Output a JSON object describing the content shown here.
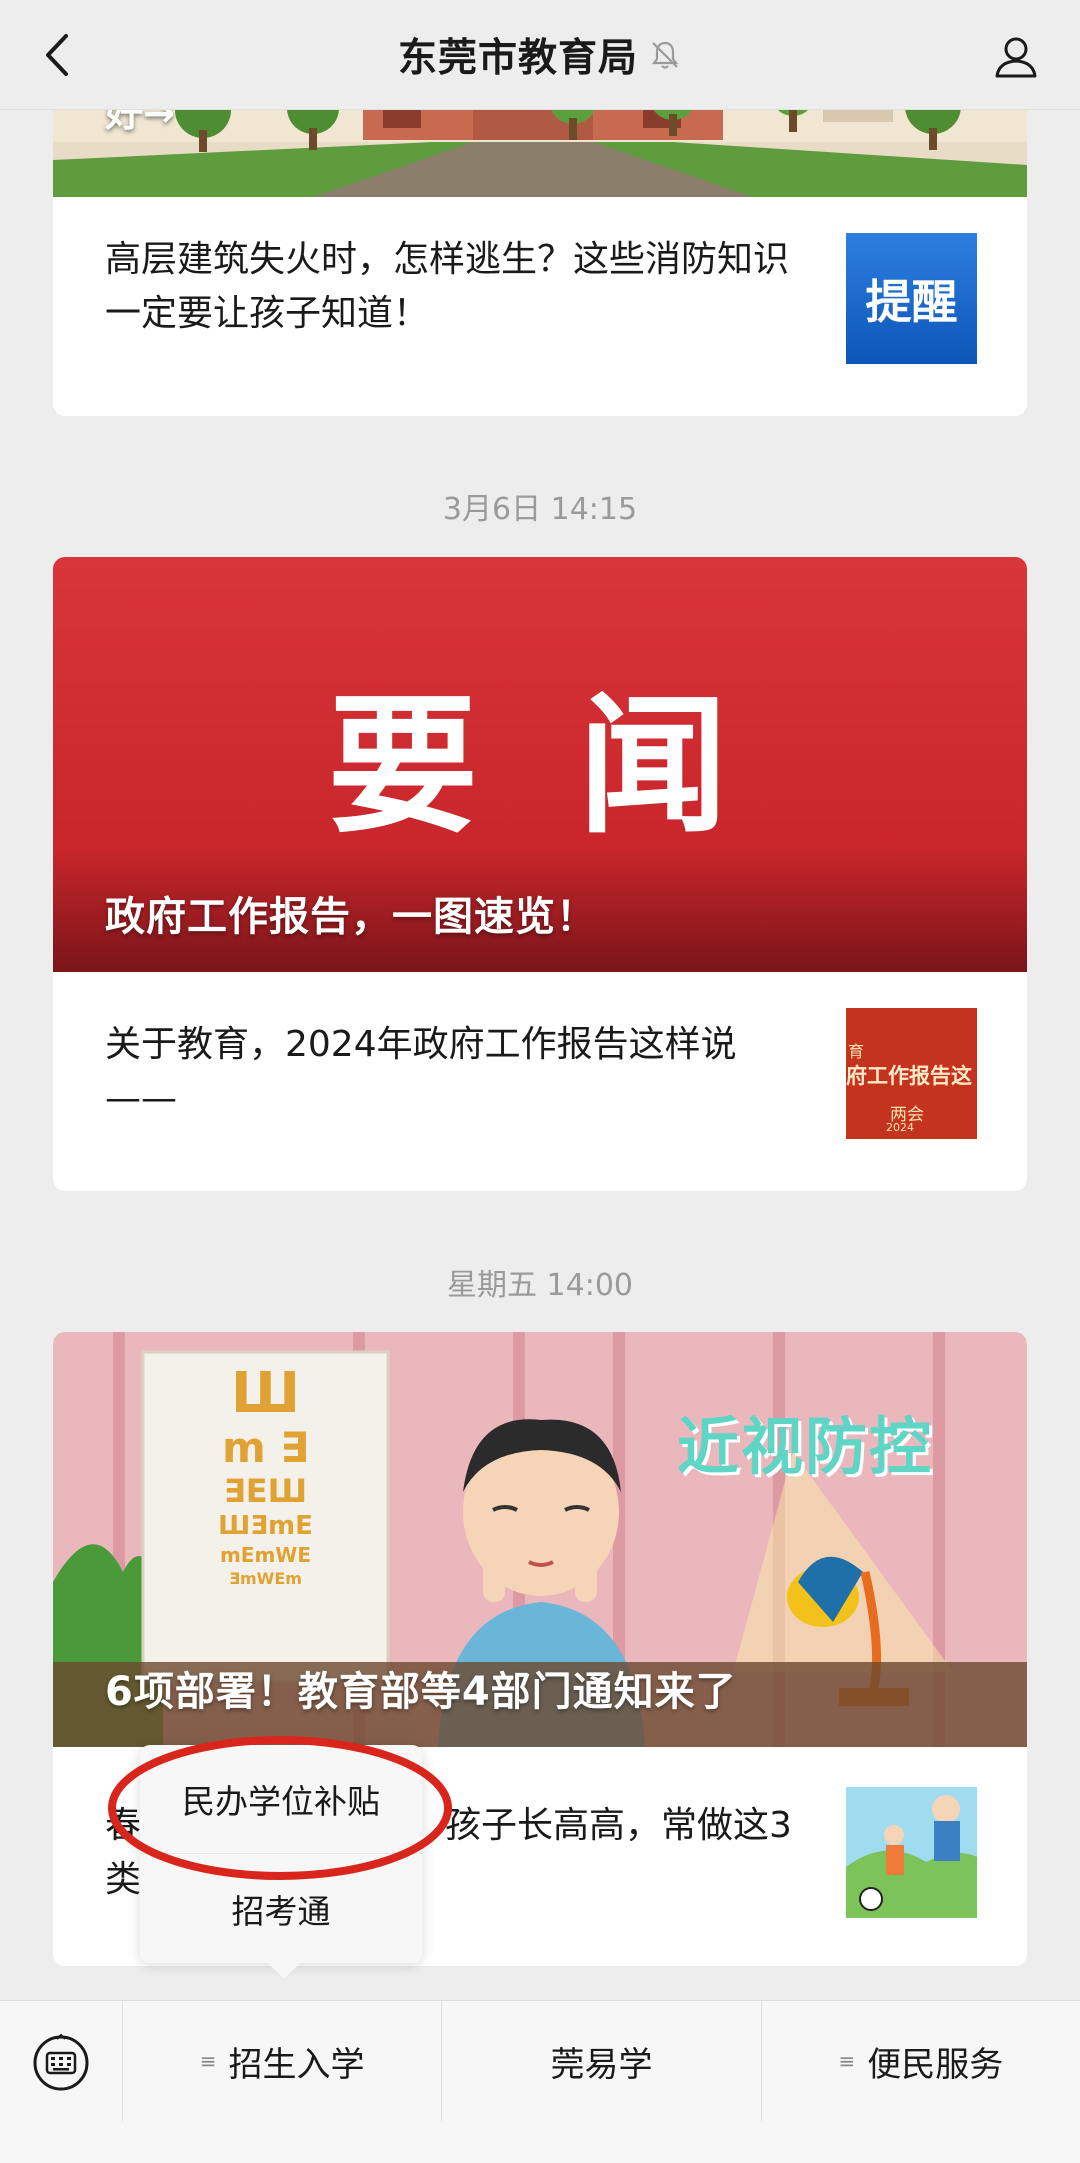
{
  "header": {
    "title": "东莞市教育局",
    "back_icon": "chevron-left-icon",
    "mute_icon": "bell-off-icon",
    "profile_icon": "person-icon"
  },
  "articles": [
    {
      "cover_title": "好→",
      "sub_text": "高层建筑失火时，怎样逃生？这些消防知识一定要让孩子知道！",
      "thumb_text": "提醒"
    },
    {
      "timestamp": "3月6日 14:15",
      "cover_big_text": "要 闻",
      "cover_title": "政府工作报告，一图速览！",
      "sub_text": "关于教育，2024年政府工作报告这样说——",
      "thumb_line1": "育",
      "thumb_line2": "府工作报告这",
      "thumb_line3": "两会",
      "thumb_line4": "2024"
    },
    {
      "timestamp": "星期五 14:00",
      "cover_badge": "近视防控",
      "cover_title": "6项部署！教育部等4部门通知来了",
      "sub_text_left": "春",
      "sub_text_left2": "类",
      "sub_text_right": "孩子长高高，常做这3"
    }
  ],
  "eye_chart_rows": [
    "Ш",
    "m ∃",
    "∃EШ",
    "ШƎmE",
    "mEmWE",
    "ƎmWEm"
  ],
  "popup_menu": {
    "items": [
      "民办学位补贴",
      "招考通"
    ]
  },
  "menu_bar": {
    "keyboard_icon": "keyboard-icon",
    "items": [
      {
        "label": "招生入学",
        "has_submenu": true
      },
      {
        "label": "莞易学",
        "has_submenu": false
      },
      {
        "label": "便民服务",
        "has_submenu": true
      }
    ]
  },
  "colors": {
    "background": "#ededed",
    "card": "#ffffff",
    "highlight_ring": "#d9261c",
    "news_red": "#c8262b",
    "thumb_blue": "#1565c0"
  }
}
